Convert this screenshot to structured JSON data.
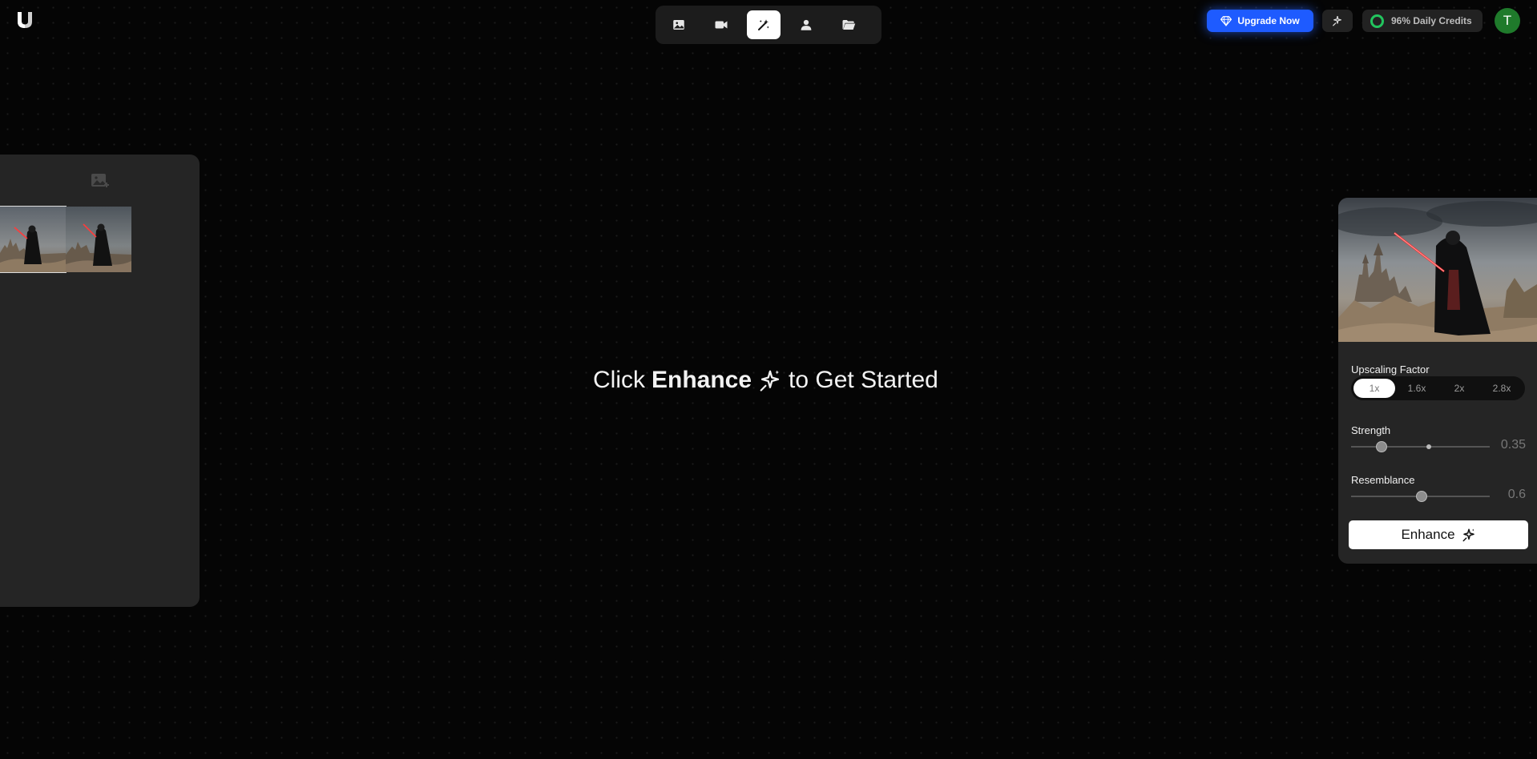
{
  "header": {
    "logo_icon": "u-logo-icon",
    "tools": [
      {
        "name": "image",
        "icon": "image-icon",
        "active": false
      },
      {
        "name": "video",
        "icon": "video-camera-icon",
        "active": false
      },
      {
        "name": "enhance",
        "icon": "magic-wand-icon",
        "active": true
      },
      {
        "name": "character",
        "icon": "person-icon",
        "active": false
      },
      {
        "name": "files",
        "icon": "folder-open-icon",
        "active": false
      }
    ],
    "upgrade_label": "Upgrade Now",
    "credits_label": "96% Daily Credits",
    "avatar_initial": "T",
    "accent_color": "#1e5bff",
    "credits_color": "#22c55e",
    "avatar_color": "#1f7a2b"
  },
  "center": {
    "prompt_prefix": "Click",
    "prompt_bold": "Enhance",
    "prompt_suffix": "to Get Started"
  },
  "panel": {
    "upscaling_label": "Upscaling Factor",
    "factors": [
      "1x",
      "1.6x",
      "2x",
      "2.8x"
    ],
    "selected_factor": "1x",
    "strength_label": "Strength",
    "strength_value": "0.35",
    "resemblance_label": "Resemblance",
    "resemblance_value": "0.6",
    "enhance_label": "Enhance"
  }
}
